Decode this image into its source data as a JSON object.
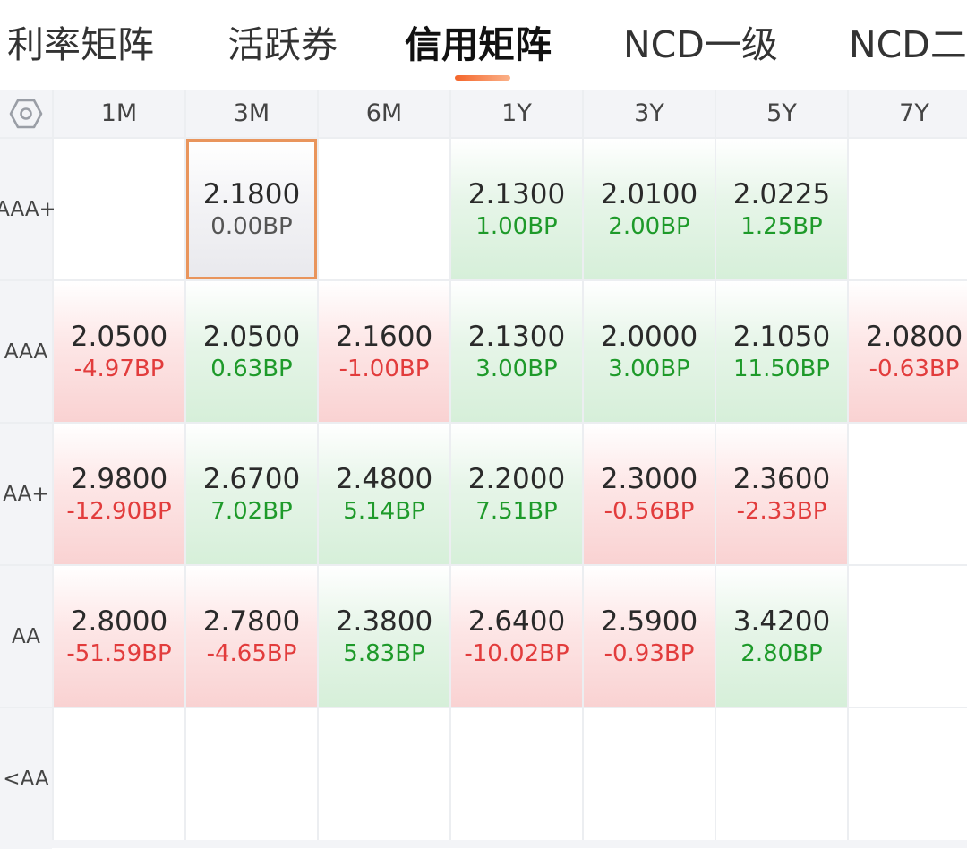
{
  "tabs": [
    {
      "label": "利率矩阵",
      "active": false
    },
    {
      "label": "活跃券",
      "active": false
    },
    {
      "label": "信用矩阵",
      "active": true
    },
    {
      "label": "NCD一级",
      "active": false
    },
    {
      "label": "NCD二",
      "active": false
    }
  ],
  "settings_icon": "hexagon-settings-icon",
  "columns": [
    "1M",
    "3M",
    "6M",
    "1Y",
    "3Y",
    "5Y",
    "7Y"
  ],
  "rows": [
    {
      "label_line1": "AAA",
      "label_line2": "+",
      "cells": [
        null,
        {
          "value": "2.1800",
          "change": "0.00BP",
          "trend": "flat",
          "selected": true
        },
        null,
        {
          "value": "2.1300",
          "change": "1.00BP",
          "trend": "up"
        },
        {
          "value": "2.0100",
          "change": "2.00BP",
          "trend": "up"
        },
        {
          "value": "2.0225",
          "change": "1.25BP",
          "trend": "up"
        },
        null
      ]
    },
    {
      "label_line1": "AAA",
      "label_line2": "",
      "cells": [
        {
          "value": "2.0500",
          "change": "-4.97BP",
          "trend": "down"
        },
        {
          "value": "2.0500",
          "change": "0.63BP",
          "trend": "up"
        },
        {
          "value": "2.1600",
          "change": "-1.00BP",
          "trend": "down"
        },
        {
          "value": "2.1300",
          "change": "3.00BP",
          "trend": "up"
        },
        {
          "value": "2.0000",
          "change": "3.00BP",
          "trend": "up"
        },
        {
          "value": "2.1050",
          "change": "11.50BP",
          "trend": "up"
        },
        {
          "value": "2.0800",
          "change": "-0.63BP",
          "trend": "down"
        }
      ]
    },
    {
      "label_line1": "AA+",
      "label_line2": "",
      "cells": [
        {
          "value": "2.9800",
          "change": "-12.90BP",
          "trend": "down"
        },
        {
          "value": "2.6700",
          "change": "7.02BP",
          "trend": "up"
        },
        {
          "value": "2.4800",
          "change": "5.14BP",
          "trend": "up"
        },
        {
          "value": "2.2000",
          "change": "7.51BP",
          "trend": "up"
        },
        {
          "value": "2.3000",
          "change": "-0.56BP",
          "trend": "down"
        },
        {
          "value": "2.3600",
          "change": "-2.33BP",
          "trend": "down"
        },
        null
      ]
    },
    {
      "label_line1": "AA",
      "label_line2": "",
      "cells": [
        {
          "value": "2.8000",
          "change": "-51.59BP",
          "trend": "down"
        },
        {
          "value": "2.7800",
          "change": "-4.65BP",
          "trend": "down"
        },
        {
          "value": "2.3800",
          "change": "5.83BP",
          "trend": "up"
        },
        {
          "value": "2.6400",
          "change": "-10.02BP",
          "trend": "down"
        },
        {
          "value": "2.5900",
          "change": "-0.93BP",
          "trend": "down"
        },
        {
          "value": "3.4200",
          "change": "2.80BP",
          "trend": "up"
        },
        null
      ]
    },
    {
      "label_line1": "<AA",
      "label_line2": "",
      "cells": [
        null,
        null,
        null,
        null,
        null,
        null,
        null
      ]
    }
  ],
  "colors": {
    "accent": "#f4652a",
    "up_text": "#1e9a2a",
    "down_text": "#e23c3c",
    "up_bg": "#d6efd9",
    "down_bg": "#f9d2d2",
    "selected_border": "#e9955c"
  }
}
